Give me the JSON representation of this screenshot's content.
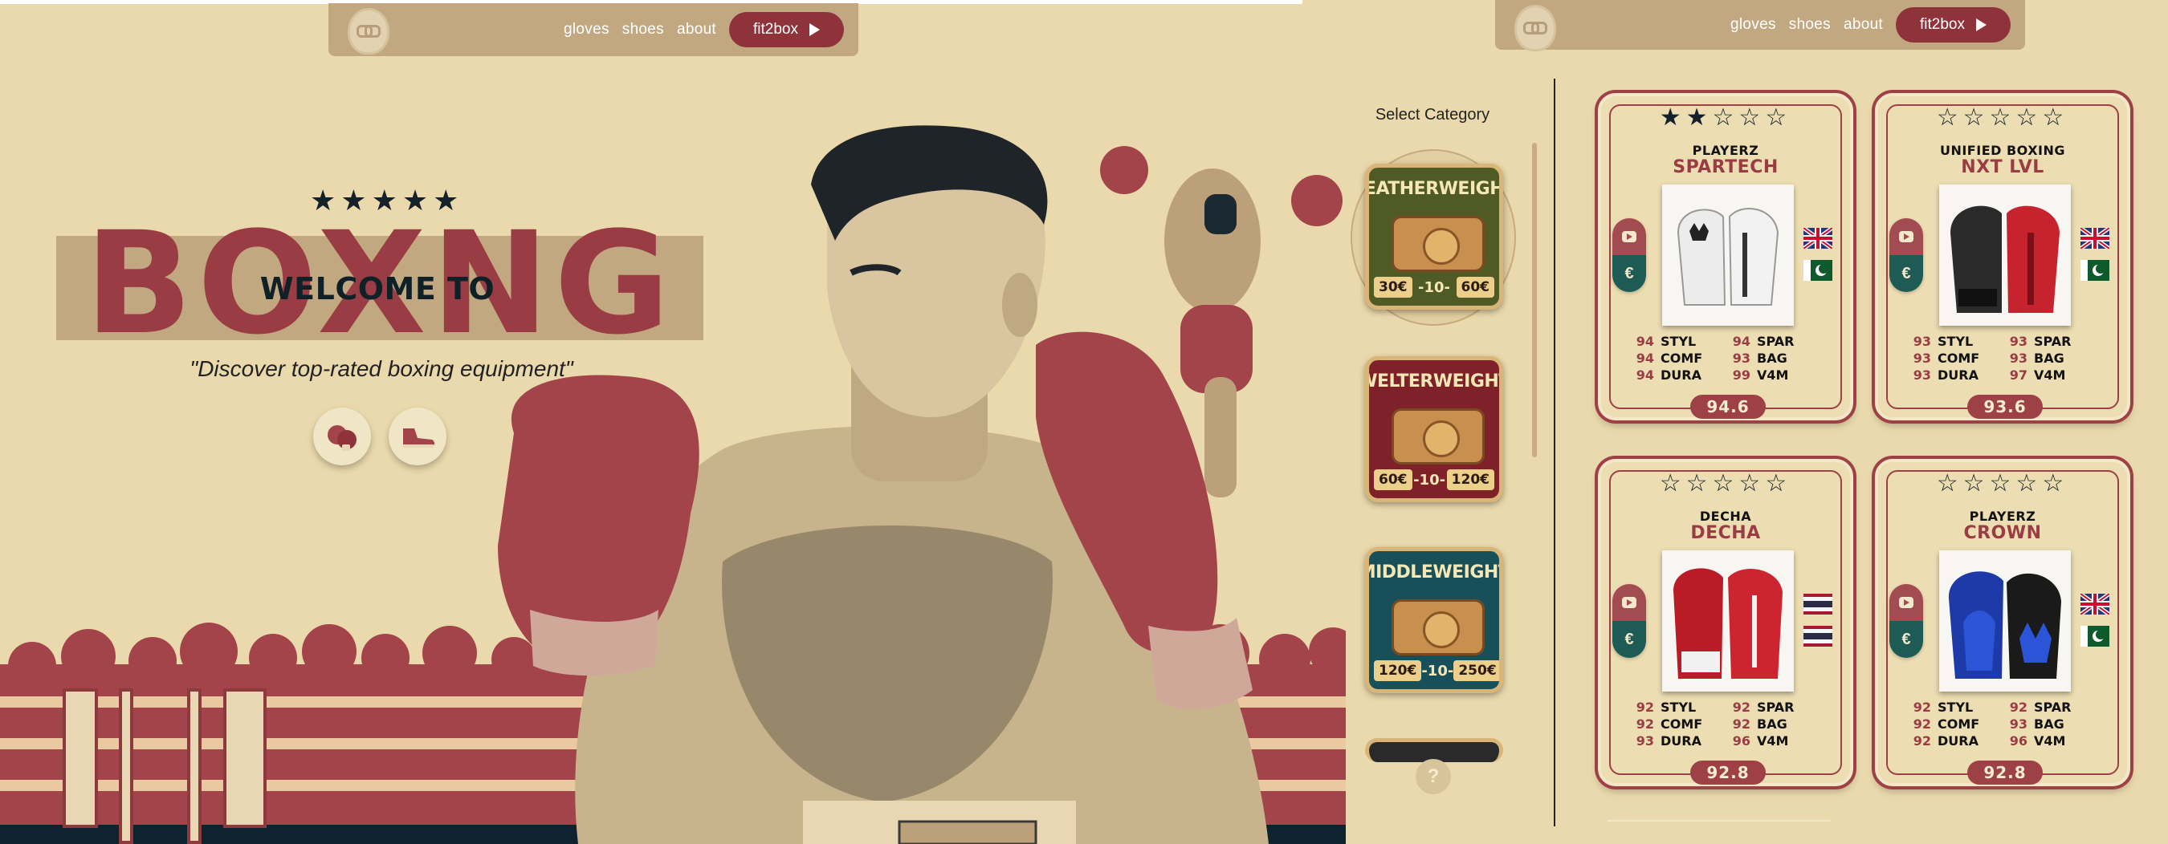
{
  "nav": {
    "links": [
      "gloves",
      "shoes",
      "about"
    ],
    "cta_label": "fit2box"
  },
  "hero": {
    "stars": "★★★★★",
    "big_title": "BOXNG",
    "welcome": "WELCOME TO",
    "tagline": "\"Discover top-rated boxing equipment\"",
    "icons": [
      "boxing-glove-icon",
      "sneaker-icon"
    ]
  },
  "sidebar": {
    "title": "Select Category",
    "categories": [
      {
        "name": "FEATHERWEIGHT",
        "price_low": "30€",
        "middle": "-10-",
        "price_high": "60€"
      },
      {
        "name": "WELTERWEIGHT",
        "price_low": "60€",
        "middle": "-10-",
        "price_high": "120€"
      },
      {
        "name": "MIDDLEWEIGHT",
        "price_low": "120€",
        "middle": "-10-",
        "price_high": "250€"
      }
    ],
    "help_label": "?"
  },
  "products": [
    {
      "stars": "★★☆☆☆",
      "rating": 2,
      "brand": "PLAYERZ",
      "model": "SPARTECH",
      "stats": [
        [
          "94",
          "STYL"
        ],
        [
          "94",
          "SPAR"
        ],
        [
          "94",
          "COMF"
        ],
        [
          "93",
          "BAG"
        ],
        [
          "94",
          "DURA"
        ],
        [
          "99",
          "V4M"
        ]
      ],
      "score": "94.6",
      "flags": [
        "uk",
        "pk"
      ]
    },
    {
      "stars": "☆☆☆☆☆",
      "rating": 0,
      "brand": "UNIFIED BOXING",
      "model": "NXT LVL",
      "stats": [
        [
          "93",
          "STYL"
        ],
        [
          "93",
          "SPAR"
        ],
        [
          "93",
          "COMF"
        ],
        [
          "93",
          "BAG"
        ],
        [
          "93",
          "DURA"
        ],
        [
          "97",
          "V4M"
        ]
      ],
      "score": "93.6",
      "flags": [
        "uk",
        "pk"
      ]
    },
    {
      "stars": "☆☆☆☆☆",
      "rating": 0,
      "brand": "DECHA",
      "model": "DECHA",
      "stats": [
        [
          "92",
          "STYL"
        ],
        [
          "92",
          "SPAR"
        ],
        [
          "92",
          "COMF"
        ],
        [
          "92",
          "BAG"
        ],
        [
          "93",
          "DURA"
        ],
        [
          "96",
          "V4M"
        ]
      ],
      "score": "92.8",
      "flags": [
        "th",
        "th"
      ]
    },
    {
      "stars": "☆☆☆☆☆",
      "rating": 0,
      "brand": "PLAYERZ",
      "model": "CROWN",
      "stats": [
        [
          "92",
          "STYL"
        ],
        [
          "92",
          "SPAR"
        ],
        [
          "92",
          "COMF"
        ],
        [
          "93",
          "BAG"
        ],
        [
          "92",
          "DURA"
        ],
        [
          "96",
          "V4M"
        ]
      ],
      "score": "92.8",
      "flags": [
        "uk",
        "pk"
      ]
    }
  ],
  "colors": {
    "background": "#ead9ac",
    "nav": "#c2a880",
    "accent_red": "#9d4147",
    "accent_green": "#1e5b55"
  }
}
